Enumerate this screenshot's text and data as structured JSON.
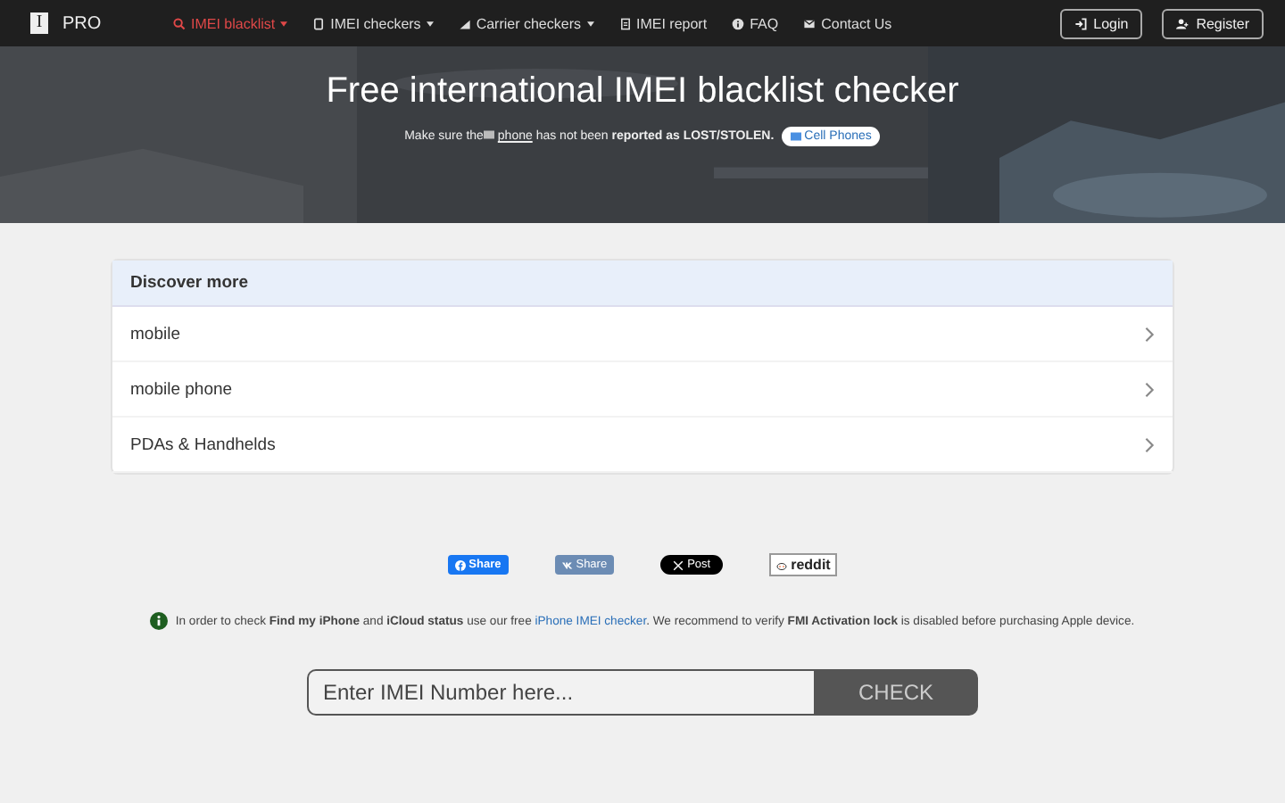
{
  "brand": {
    "logo": "I",
    "name": "PRO"
  },
  "nav": [
    {
      "label": "IMEI blacklist",
      "kind": "search",
      "dropdown": true,
      "selected": true
    },
    {
      "label": "IMEI checkers",
      "kind": "phone",
      "dropdown": true,
      "selected": false
    },
    {
      "label": "Carrier checkers",
      "kind": "signal",
      "dropdown": true,
      "selected": false
    },
    {
      "label": "IMEI report",
      "kind": "doc",
      "dropdown": false,
      "selected": false
    },
    {
      "label": "FAQ",
      "kind": "info",
      "dropdown": false,
      "selected": false
    },
    {
      "label": "Contact Us",
      "kind": "mail",
      "dropdown": false,
      "selected": false
    }
  ],
  "auth_buttons": [
    {
      "label": "Login",
      "kind": "login"
    },
    {
      "label": "Register",
      "kind": "register"
    }
  ],
  "hero": {
    "title": "Free international IMEI blacklist checker",
    "subtitle_before": "Make sure the",
    "subtitle_link": "phone",
    "subtitle_after": "has not been **reported as LOST/STOLEN.**",
    "tag": "Cell Phones"
  },
  "discover": {
    "title": "Discover more",
    "items": [
      "mobile",
      "mobile phone",
      "PDAs & Handhelds"
    ]
  },
  "share_buttons": [
    {
      "kind": "facebook",
      "label": "Share"
    },
    {
      "kind": "vk",
      "label": "Share"
    },
    {
      "kind": "x",
      "label": "Post"
    },
    {
      "kind": "reddit",
      "label": "reddit"
    }
  ],
  "info": {
    "before": "In order to check **Find my iPhone** and **iCloud status** use our free",
    "link": "iPhone IMEI checker",
    "after": ". We recommend to verify **FMI Activation lock** is disabled before purchasing Apple device."
  },
  "check": {
    "placeholder": "Enter IMEI Number here...",
    "button": "CHECK"
  }
}
